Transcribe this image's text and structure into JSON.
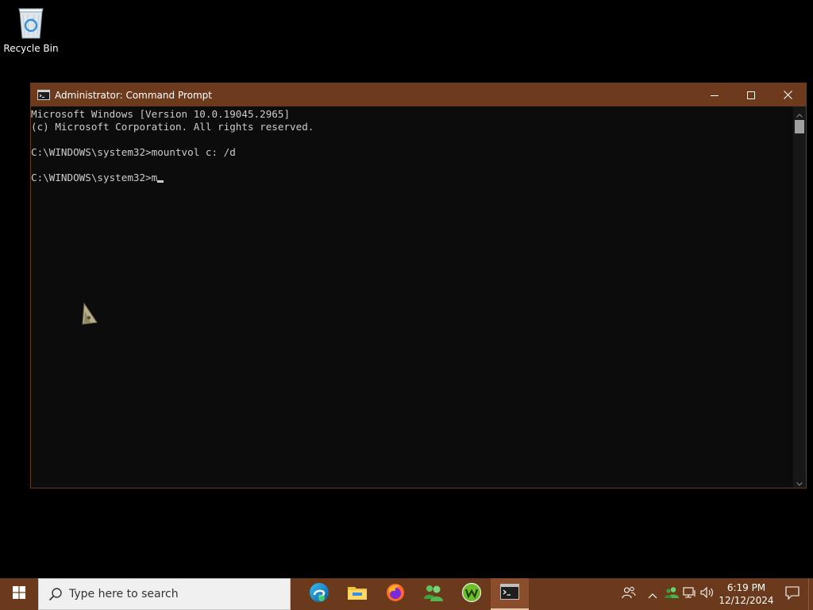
{
  "desktop": {
    "icons": [
      {
        "label": "Recycle Bin",
        "icon": "recycle-bin-icon"
      }
    ]
  },
  "window": {
    "title": "Administrator: Command Prompt",
    "icon": "command-prompt-icon",
    "controls": [
      "minimize-icon",
      "maximize-icon",
      "close-icon"
    ],
    "console_lines": [
      "Microsoft Windows [Version 10.0.19045.2965]",
      "(c) Microsoft Corporation. All rights reserved.",
      "",
      "C:\\WINDOWS\\system32>mountvol c: /d",
      "",
      "C:\\WINDOWS\\system32>m"
    ]
  },
  "taskbar": {
    "start_icon": "windows-logo-icon",
    "search_placeholder": "Type here to search",
    "apps": [
      {
        "name": "Microsoft Edge",
        "icon": "edge-icon"
      },
      {
        "name": "File Explorer",
        "icon": "file-explorer-icon"
      },
      {
        "name": "Firefox",
        "icon": "firefox-icon"
      },
      {
        "name": "Users",
        "icon": "users-icon"
      },
      {
        "name": "Webroot",
        "icon": "webroot-icon"
      },
      {
        "name": "Command Prompt",
        "icon": "command-prompt-icon",
        "active": true
      }
    ],
    "tray": {
      "time": "6:19 PM",
      "date": "12/12/2024"
    }
  },
  "colors": {
    "accent": "#6e3a1d",
    "console_bg": "#0c0c0c",
    "console_fg": "#cccccc"
  }
}
